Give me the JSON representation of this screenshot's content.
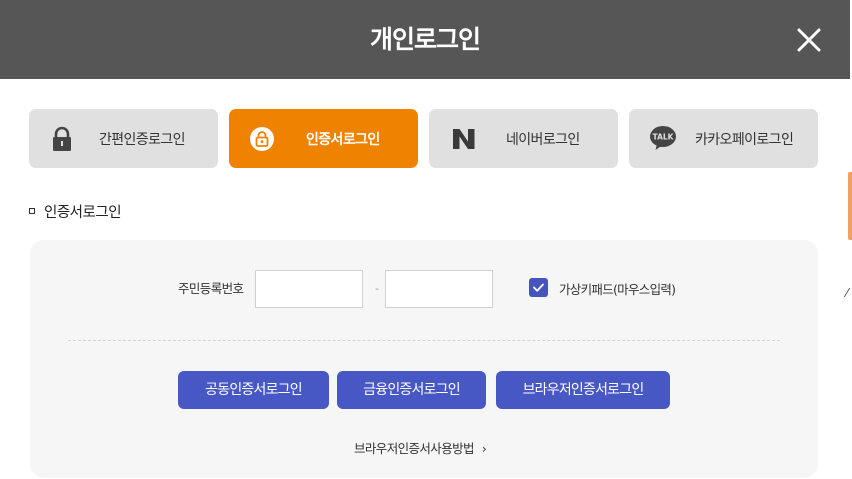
{
  "header": {
    "title": "개인로그인"
  },
  "tabs": [
    {
      "label": "간편인증로그인",
      "icon": "lock-icon",
      "active": false
    },
    {
      "label": "인증서로그인",
      "icon": "certificate-lock-icon",
      "active": true
    },
    {
      "label": "네이버로그인",
      "icon": "naver-icon",
      "active": false
    },
    {
      "label": "카카오페이로그인",
      "icon": "kakaotalk-icon",
      "icon_text": "TALK",
      "active": false
    }
  ],
  "section": {
    "title": "인증서로그인"
  },
  "form": {
    "rrn_label": "주민등록번호",
    "rrn_front_value": "",
    "rrn_back_value": "",
    "separator": "-",
    "keypad_checked": true,
    "keypad_label": "가상키패드(마우스입력)"
  },
  "buttons": [
    {
      "label": "공동인증서로그인"
    },
    {
      "label": "금융인증서로그인"
    },
    {
      "label": "브라우저인증서로그인"
    }
  ],
  "guide_link": {
    "label": "브라우저인증서사용방법",
    "chevron": "›"
  },
  "colors": {
    "header_bg": "#565656",
    "active_tab": "#ef8200",
    "tab_bg": "#e0e0e0",
    "primary_button": "#4757c3",
    "panel_bg": "#f6f6f6"
  }
}
